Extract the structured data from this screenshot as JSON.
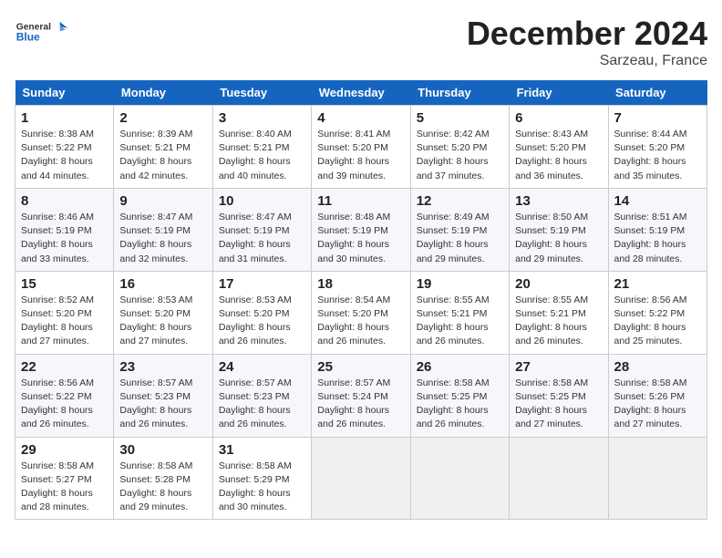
{
  "header": {
    "logo_general": "General",
    "logo_blue": "Blue",
    "month_year": "December 2024",
    "location": "Sarzeau, France"
  },
  "weekdays": [
    "Sunday",
    "Monday",
    "Tuesday",
    "Wednesday",
    "Thursday",
    "Friday",
    "Saturday"
  ],
  "weeks": [
    [
      {
        "day": "1",
        "sunrise": "Sunrise: 8:38 AM",
        "sunset": "Sunset: 5:22 PM",
        "daylight": "Daylight: 8 hours and 44 minutes."
      },
      {
        "day": "2",
        "sunrise": "Sunrise: 8:39 AM",
        "sunset": "Sunset: 5:21 PM",
        "daylight": "Daylight: 8 hours and 42 minutes."
      },
      {
        "day": "3",
        "sunrise": "Sunrise: 8:40 AM",
        "sunset": "Sunset: 5:21 PM",
        "daylight": "Daylight: 8 hours and 40 minutes."
      },
      {
        "day": "4",
        "sunrise": "Sunrise: 8:41 AM",
        "sunset": "Sunset: 5:20 PM",
        "daylight": "Daylight: 8 hours and 39 minutes."
      },
      {
        "day": "5",
        "sunrise": "Sunrise: 8:42 AM",
        "sunset": "Sunset: 5:20 PM",
        "daylight": "Daylight: 8 hours and 37 minutes."
      },
      {
        "day": "6",
        "sunrise": "Sunrise: 8:43 AM",
        "sunset": "Sunset: 5:20 PM",
        "daylight": "Daylight: 8 hours and 36 minutes."
      },
      {
        "day": "7",
        "sunrise": "Sunrise: 8:44 AM",
        "sunset": "Sunset: 5:20 PM",
        "daylight": "Daylight: 8 hours and 35 minutes."
      }
    ],
    [
      {
        "day": "8",
        "sunrise": "Sunrise: 8:46 AM",
        "sunset": "Sunset: 5:19 PM",
        "daylight": "Daylight: 8 hours and 33 minutes."
      },
      {
        "day": "9",
        "sunrise": "Sunrise: 8:47 AM",
        "sunset": "Sunset: 5:19 PM",
        "daylight": "Daylight: 8 hours and 32 minutes."
      },
      {
        "day": "10",
        "sunrise": "Sunrise: 8:47 AM",
        "sunset": "Sunset: 5:19 PM",
        "daylight": "Daylight: 8 hours and 31 minutes."
      },
      {
        "day": "11",
        "sunrise": "Sunrise: 8:48 AM",
        "sunset": "Sunset: 5:19 PM",
        "daylight": "Daylight: 8 hours and 30 minutes."
      },
      {
        "day": "12",
        "sunrise": "Sunrise: 8:49 AM",
        "sunset": "Sunset: 5:19 PM",
        "daylight": "Daylight: 8 hours and 29 minutes."
      },
      {
        "day": "13",
        "sunrise": "Sunrise: 8:50 AM",
        "sunset": "Sunset: 5:19 PM",
        "daylight": "Daylight: 8 hours and 29 minutes."
      },
      {
        "day": "14",
        "sunrise": "Sunrise: 8:51 AM",
        "sunset": "Sunset: 5:19 PM",
        "daylight": "Daylight: 8 hours and 28 minutes."
      }
    ],
    [
      {
        "day": "15",
        "sunrise": "Sunrise: 8:52 AM",
        "sunset": "Sunset: 5:20 PM",
        "daylight": "Daylight: 8 hours and 27 minutes."
      },
      {
        "day": "16",
        "sunrise": "Sunrise: 8:53 AM",
        "sunset": "Sunset: 5:20 PM",
        "daylight": "Daylight: 8 hours and 27 minutes."
      },
      {
        "day": "17",
        "sunrise": "Sunrise: 8:53 AM",
        "sunset": "Sunset: 5:20 PM",
        "daylight": "Daylight: 8 hours and 26 minutes."
      },
      {
        "day": "18",
        "sunrise": "Sunrise: 8:54 AM",
        "sunset": "Sunset: 5:20 PM",
        "daylight": "Daylight: 8 hours and 26 minutes."
      },
      {
        "day": "19",
        "sunrise": "Sunrise: 8:55 AM",
        "sunset": "Sunset: 5:21 PM",
        "daylight": "Daylight: 8 hours and 26 minutes."
      },
      {
        "day": "20",
        "sunrise": "Sunrise: 8:55 AM",
        "sunset": "Sunset: 5:21 PM",
        "daylight": "Daylight: 8 hours and 26 minutes."
      },
      {
        "day": "21",
        "sunrise": "Sunrise: 8:56 AM",
        "sunset": "Sunset: 5:22 PM",
        "daylight": "Daylight: 8 hours and 25 minutes."
      }
    ],
    [
      {
        "day": "22",
        "sunrise": "Sunrise: 8:56 AM",
        "sunset": "Sunset: 5:22 PM",
        "daylight": "Daylight: 8 hours and 26 minutes."
      },
      {
        "day": "23",
        "sunrise": "Sunrise: 8:57 AM",
        "sunset": "Sunset: 5:23 PM",
        "daylight": "Daylight: 8 hours and 26 minutes."
      },
      {
        "day": "24",
        "sunrise": "Sunrise: 8:57 AM",
        "sunset": "Sunset: 5:23 PM",
        "daylight": "Daylight: 8 hours and 26 minutes."
      },
      {
        "day": "25",
        "sunrise": "Sunrise: 8:57 AM",
        "sunset": "Sunset: 5:24 PM",
        "daylight": "Daylight: 8 hours and 26 minutes."
      },
      {
        "day": "26",
        "sunrise": "Sunrise: 8:58 AM",
        "sunset": "Sunset: 5:25 PM",
        "daylight": "Daylight: 8 hours and 26 minutes."
      },
      {
        "day": "27",
        "sunrise": "Sunrise: 8:58 AM",
        "sunset": "Sunset: 5:25 PM",
        "daylight": "Daylight: 8 hours and 27 minutes."
      },
      {
        "day": "28",
        "sunrise": "Sunrise: 8:58 AM",
        "sunset": "Sunset: 5:26 PM",
        "daylight": "Daylight: 8 hours and 27 minutes."
      }
    ],
    [
      {
        "day": "29",
        "sunrise": "Sunrise: 8:58 AM",
        "sunset": "Sunset: 5:27 PM",
        "daylight": "Daylight: 8 hours and 28 minutes."
      },
      {
        "day": "30",
        "sunrise": "Sunrise: 8:58 AM",
        "sunset": "Sunset: 5:28 PM",
        "daylight": "Daylight: 8 hours and 29 minutes."
      },
      {
        "day": "31",
        "sunrise": "Sunrise: 8:58 AM",
        "sunset": "Sunset: 5:29 PM",
        "daylight": "Daylight: 8 hours and 30 minutes."
      },
      null,
      null,
      null,
      null
    ]
  ]
}
